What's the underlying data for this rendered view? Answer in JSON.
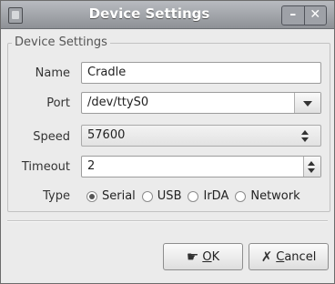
{
  "window": {
    "title": "Device Settings",
    "minimize_label": "–",
    "close_label": "✕"
  },
  "frame": {
    "label": "Device Settings"
  },
  "fields": {
    "name": {
      "label": "Name",
      "value": "Cradle"
    },
    "port": {
      "label": "Port",
      "value": "/dev/ttyS0"
    },
    "speed": {
      "label": "Speed",
      "value": "57600"
    },
    "timeout": {
      "label": "Timeout",
      "value": "2"
    }
  },
  "type": {
    "label": "Type",
    "options": [
      "Serial",
      "USB",
      "IrDA",
      "Network"
    ],
    "selected": "Serial"
  },
  "buttons": {
    "ok": {
      "mnemonic": "O",
      "rest": "K"
    },
    "cancel": {
      "mnemonic": "C",
      "rest": "ancel"
    }
  },
  "icons": {
    "window_menu": "window-menu-icon",
    "ok": "ok-hand-icon",
    "cancel": "cancel-x-icon"
  }
}
